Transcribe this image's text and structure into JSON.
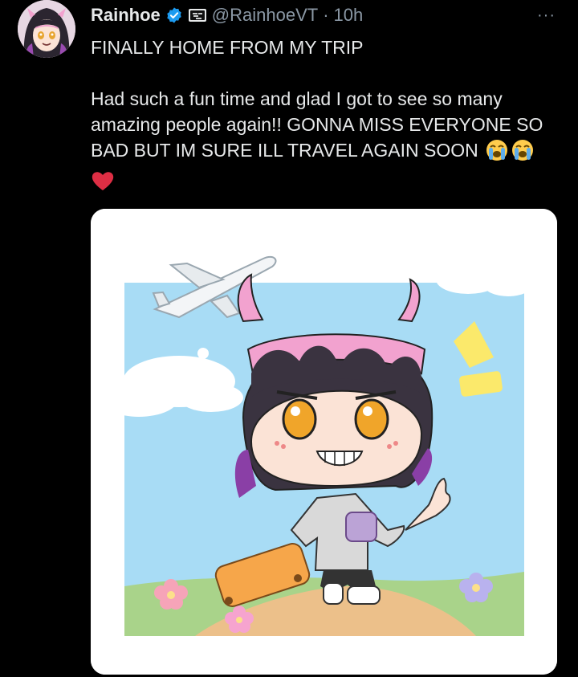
{
  "author": {
    "display_name": "Rainhoe",
    "handle": "@RainhoeVT",
    "separator": "·",
    "time": "10h",
    "verified_icon": "verified-badge-icon",
    "affiliate_icon": "affiliate-badge-icon"
  },
  "tweet": {
    "line1": "FINALLY HOME FROM MY TRIP",
    "body": "Had such a fun time and glad I got to see so many amazing people again!! GONNA MISS EVERYONE SO BAD BUT IM SURE ILL TRAVEL AGAIN SOON",
    "emojis": [
      "loudly-crying-face-icon",
      "loudly-crying-face-icon",
      "red-heart-icon"
    ]
  },
  "more_icon": "more-options-icon",
  "more_label": "···",
  "media": {
    "type": "illustration",
    "subject": "chibi-character-waving-with-suitcase-and-airplane"
  },
  "colors": {
    "background": "#000000",
    "text": "#e7e9ea",
    "muted": "#8b98a5",
    "verified": "#1d9bf0",
    "sky": "#a8dcf5",
    "path": "#ecc08a",
    "grass": "#a9d38a"
  }
}
